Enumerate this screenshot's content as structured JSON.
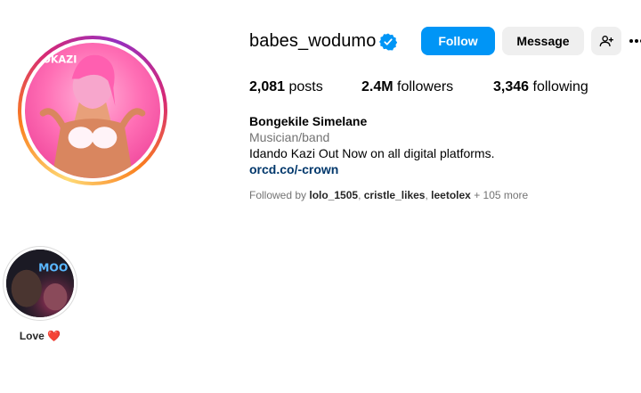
{
  "profile": {
    "username": "babes_wodumo",
    "verified": true,
    "full_name": "Bongekile Simelane",
    "category": "Musician/band",
    "bio": "Idando Kazi Out Now on all digital platforms.",
    "link": "orcd.co/-crown",
    "avatar_text": "IDOKAZI"
  },
  "actions": {
    "follow": "Follow",
    "message": "Message"
  },
  "stats": {
    "posts_count": "2,081",
    "posts_label": "posts",
    "followers_count": "2.4M",
    "followers_label": "followers",
    "following_count": "3,346",
    "following_label": "following"
  },
  "followed_by": {
    "prefix": "Followed by",
    "users": [
      "lolo_1505",
      "cristle_likes",
      "leetolex"
    ],
    "more": "+ 105 more"
  },
  "highlights": [
    {
      "label": "Love ❤️",
      "cover_text": "MOO"
    }
  ],
  "colors": {
    "accent": "#0095f6",
    "link": "#00376b",
    "secondary_text": "#737373",
    "button_bg": "#efefef"
  }
}
